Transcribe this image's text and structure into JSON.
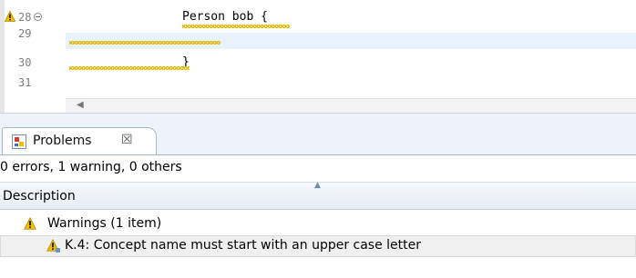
{
  "editor": {
    "lines": [
      {
        "number": "28",
        "code": "Person bob {"
      },
      {
        "number": "29",
        "code": ""
      },
      {
        "number": "30",
        "code": "}"
      },
      {
        "number": "31",
        "code": ""
      }
    ],
    "icons": {
      "warning_marker": "warning-icon",
      "fold": "collapse-icon",
      "scroll_left": "scroll-left-arrow-icon"
    }
  },
  "problems_view": {
    "tab_label": "Problems",
    "tab_close": "☒",
    "tab_icon": "problems-view-icon",
    "summary": "0 errors, 1 warning, 0 others",
    "column_header": "Description",
    "group_label": "Warnings (1 item)",
    "items": [
      {
        "label": "K.4: Concept name must start with an upper case letter",
        "icon": "warning-icon"
      }
    ]
  },
  "colors": {
    "current_line": "#e8f2fe",
    "warning": "#f0c000",
    "tab_bar": "#eef3fa",
    "header": "#e7edf5",
    "selected_row": "#f0f0f0"
  }
}
